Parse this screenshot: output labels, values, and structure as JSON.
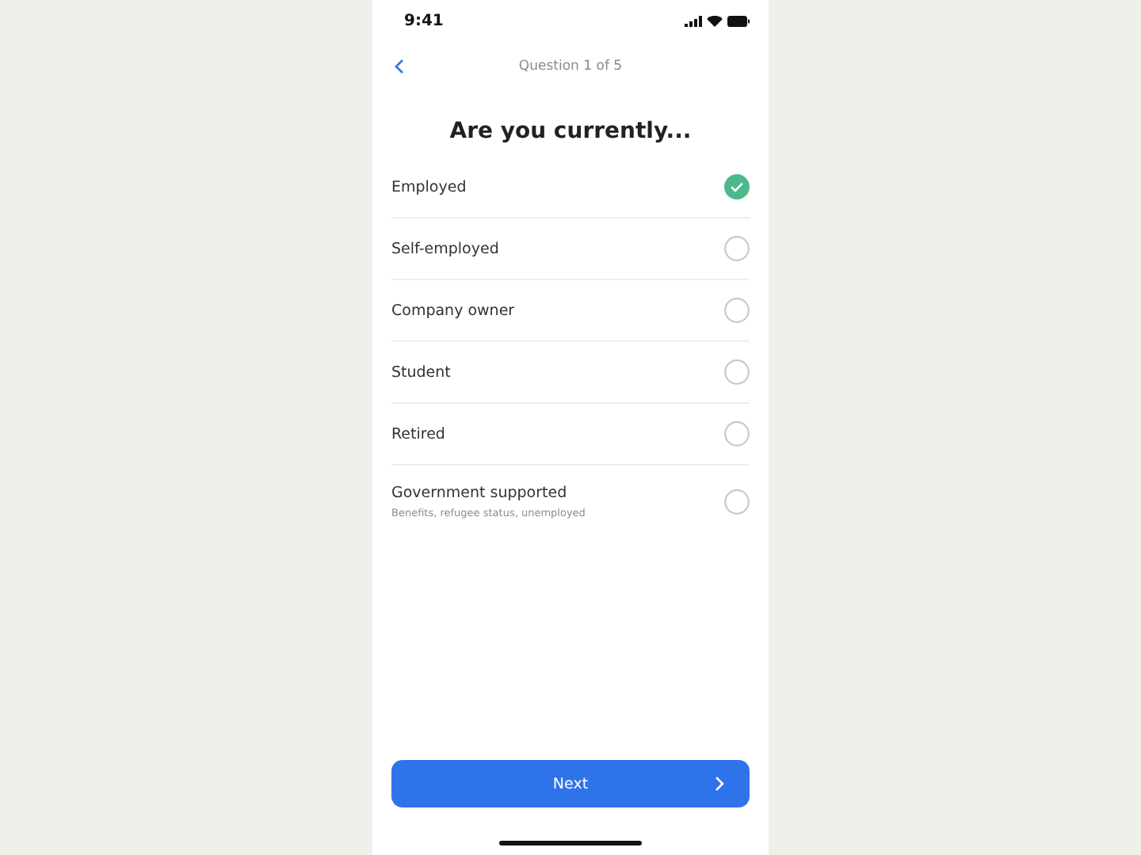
{
  "status_bar": {
    "time": "9:41"
  },
  "header": {
    "progress": "Question 1 of 5"
  },
  "title": "Are you currently...",
  "options": [
    {
      "label": "Employed",
      "selected": true
    },
    {
      "label": "Self-employed",
      "selected": false
    },
    {
      "label": "Company owner",
      "selected": false
    },
    {
      "label": "Student",
      "selected": false
    },
    {
      "label": "Retired",
      "selected": false
    },
    {
      "label": "Government supported",
      "hint": "Benefits, refugee status, unemployed",
      "selected": false
    }
  ],
  "next_button": {
    "label": "Next"
  }
}
